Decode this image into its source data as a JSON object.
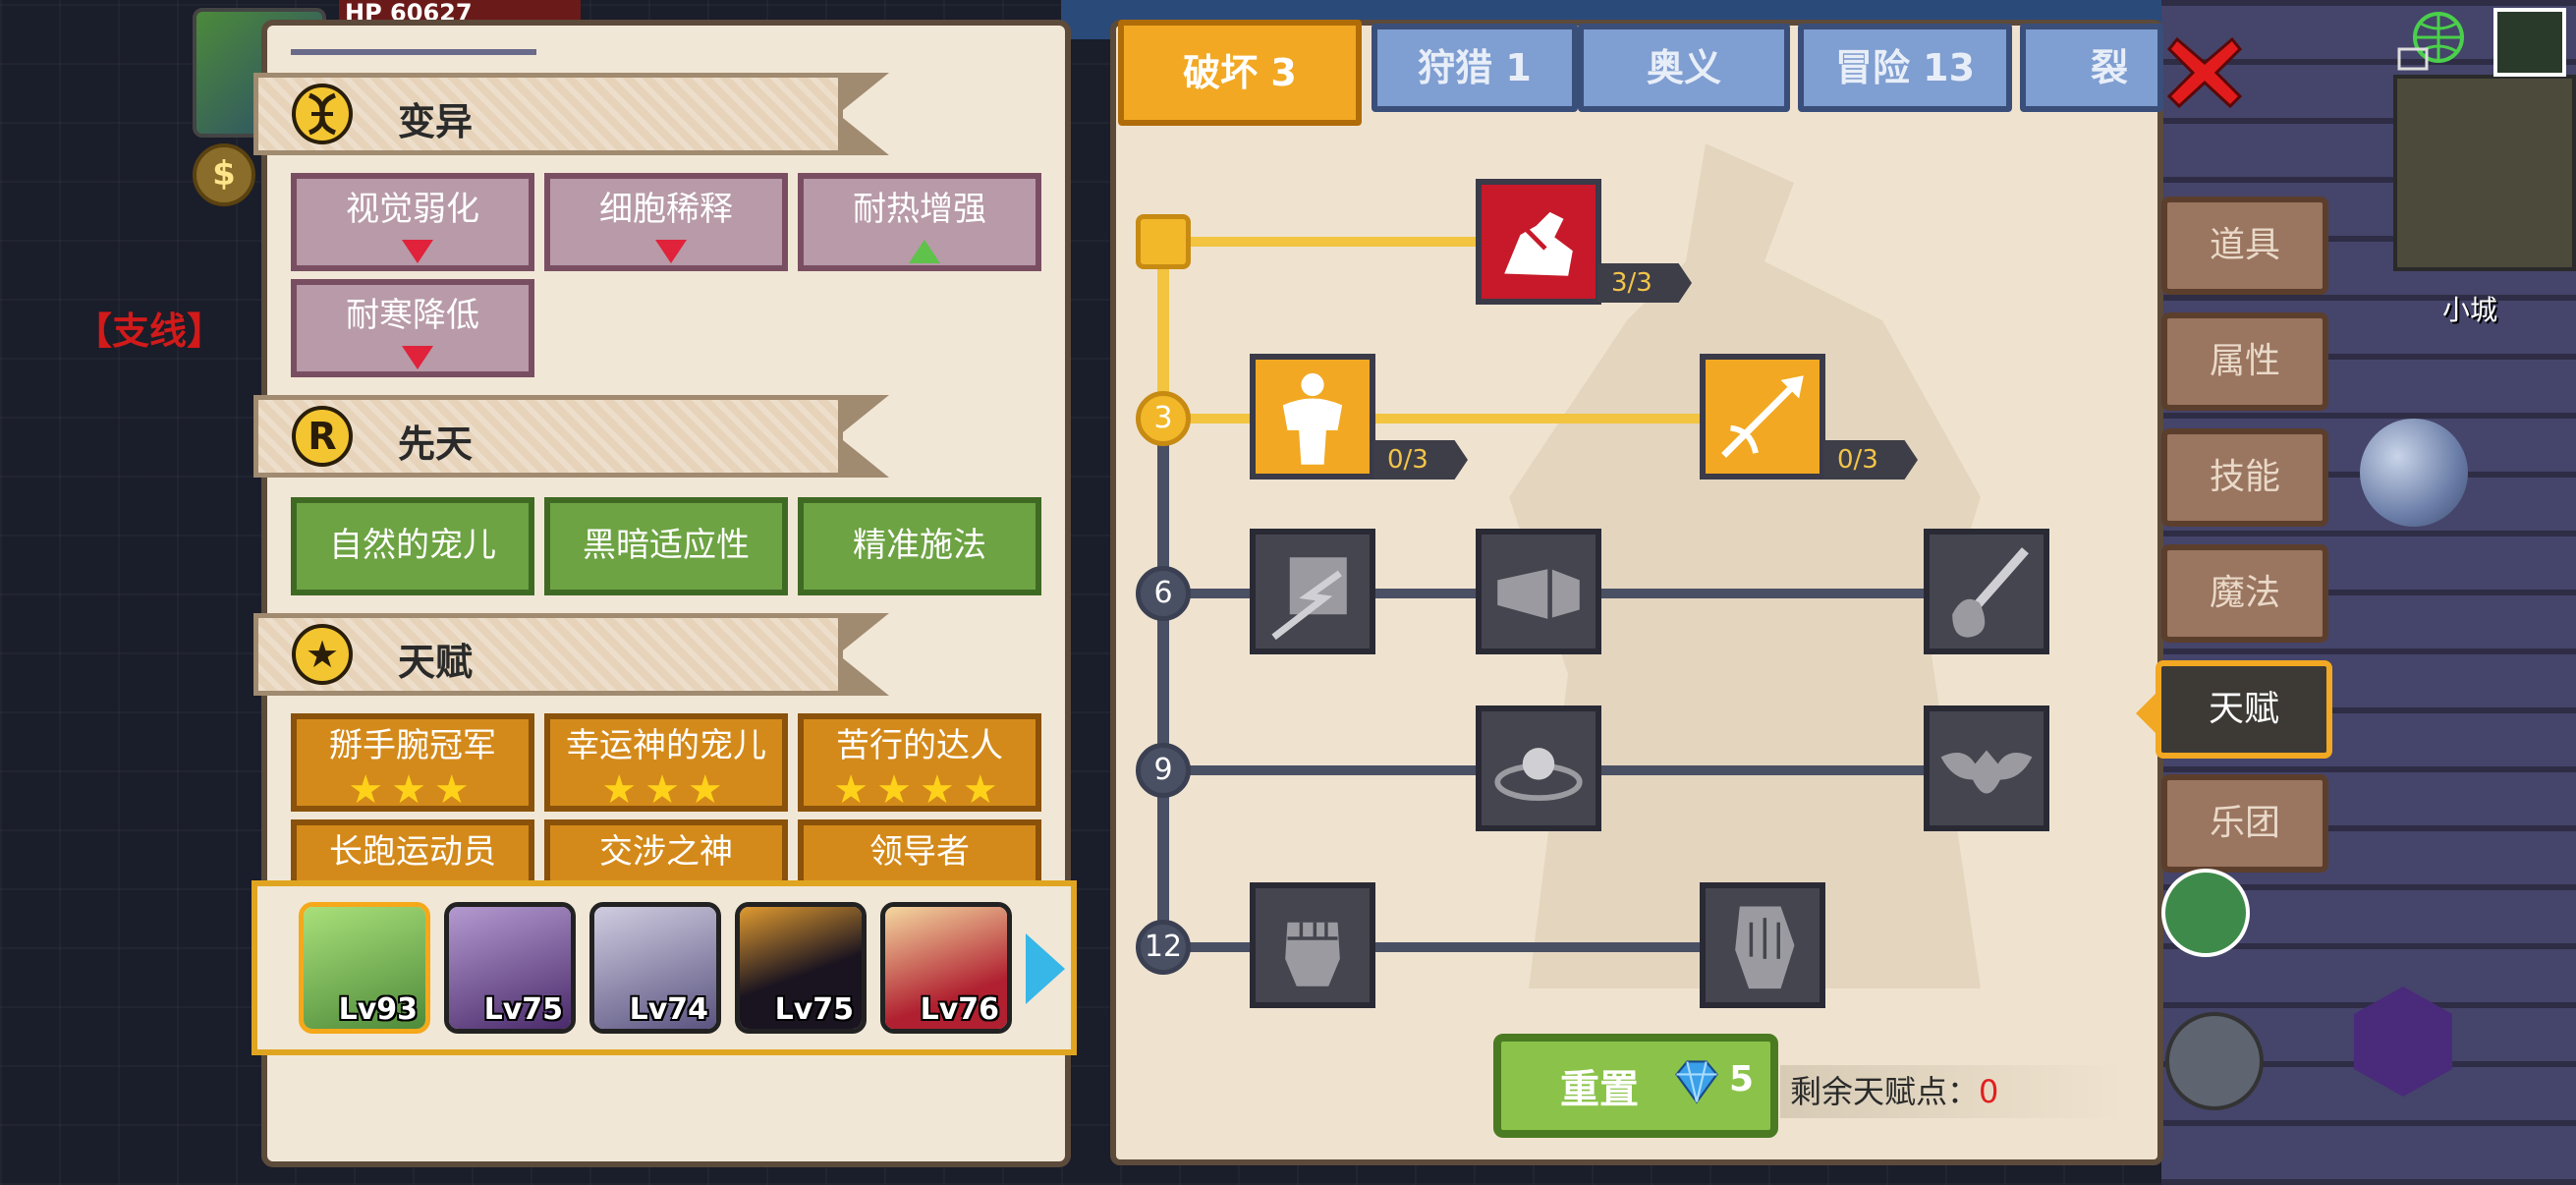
{
  "world": {
    "side_quest": "【支线】",
    "hp_label": "HP",
    "hp_value": "60627",
    "minimap_label": "小城"
  },
  "left_panel": {
    "sections": [
      {
        "key": "mutation",
        "title": "变异",
        "icon": "dna-icon"
      },
      {
        "key": "innate",
        "title": "先天",
        "icon": "r-coin-icon"
      },
      {
        "key": "talent",
        "title": "天赋",
        "icon": "star-icon"
      }
    ],
    "mutations": [
      {
        "label": "视觉弱化",
        "trend": "down"
      },
      {
        "label": "细胞稀释",
        "trend": "down"
      },
      {
        "label": "耐热增强",
        "trend": "up"
      },
      {
        "label": "耐寒降低",
        "trend": "down"
      }
    ],
    "innates": [
      {
        "label": "自然的宠儿"
      },
      {
        "label": "黑暗适应性"
      },
      {
        "label": "精准施法"
      }
    ],
    "talents": [
      {
        "label": "掰手腕冠军",
        "stars": 3
      },
      {
        "label": "幸运神的宠儿",
        "stars": 3
      },
      {
        "label": "苦行的达人",
        "stars": 4
      },
      {
        "label": "长跑运动员",
        "stars": 0
      },
      {
        "label": "交涉之神",
        "stars": 0
      },
      {
        "label": "领导者",
        "stars": 0
      }
    ],
    "team": [
      {
        "level": "Lv93",
        "selected": true,
        "color": "#7fbf5a"
      },
      {
        "level": "Lv75",
        "selected": false,
        "color": "#7a5a9a"
      },
      {
        "level": "Lv74",
        "selected": false,
        "color": "#8a84a8"
      },
      {
        "level": "Lv75",
        "selected": false,
        "color": "#3a2a3a"
      },
      {
        "level": "Lv76",
        "selected": false,
        "color": "#c8a070"
      }
    ]
  },
  "tabs": [
    {
      "label": "破坏 3",
      "active": true
    },
    {
      "label": "狩猎 1",
      "active": false
    },
    {
      "label": "奥义",
      "active": false
    },
    {
      "label": "冒险 13",
      "active": false
    },
    {
      "label": "裂痕",
      "active": false
    }
  ],
  "tree": {
    "levels": [
      {
        "label": "",
        "active": true
      },
      {
        "label": "3",
        "active": true
      },
      {
        "label": "6",
        "active": false
      },
      {
        "label": "9",
        "active": false
      },
      {
        "label": "12",
        "active": false
      }
    ],
    "nodes": [
      {
        "name": "arm-wrestle-talent",
        "icon": "arm-wrestle-icon",
        "state": "red",
        "progress": "3/3"
      },
      {
        "name": "strength-talent",
        "icon": "muscle-body-icon",
        "state": "on",
        "progress": "0/3"
      },
      {
        "name": "arrow-talent",
        "icon": "arrow-burst-icon",
        "state": "on",
        "progress": "0/3"
      },
      {
        "name": "shield-strike-talent",
        "icon": "shield-strike-icon",
        "state": "off"
      },
      {
        "name": "punch-talent",
        "icon": "punch-icon",
        "state": "off"
      },
      {
        "name": "splash-talent",
        "icon": "splash-icon",
        "state": "off"
      },
      {
        "name": "ripple-talent",
        "icon": "ripple-icon",
        "state": "off"
      },
      {
        "name": "bat-talent",
        "icon": "bat-icon",
        "state": "off"
      },
      {
        "name": "fist-talent",
        "icon": "fist-icon",
        "state": "off"
      },
      {
        "name": "grip-talent",
        "icon": "grip-icon",
        "state": "off"
      }
    ]
  },
  "reset": {
    "label": "重置",
    "cost": "5",
    "gem_icon": "diamond-icon"
  },
  "points": {
    "label": "剩余天赋点：",
    "value": "0"
  },
  "menu": [
    {
      "label": "道具",
      "active": false
    },
    {
      "label": "属性",
      "active": false
    },
    {
      "label": "技能",
      "active": false
    },
    {
      "label": "魔法",
      "active": false
    },
    {
      "label": "天赋",
      "active": true
    },
    {
      "label": "乐团",
      "active": false
    }
  ],
  "colors": {
    "accent": "#f2a822",
    "active_node": "#f2a822",
    "locked_node": "#45454f",
    "mutation": "#b89aa8",
    "innate": "#6da343",
    "talent": "#d48a1a"
  }
}
